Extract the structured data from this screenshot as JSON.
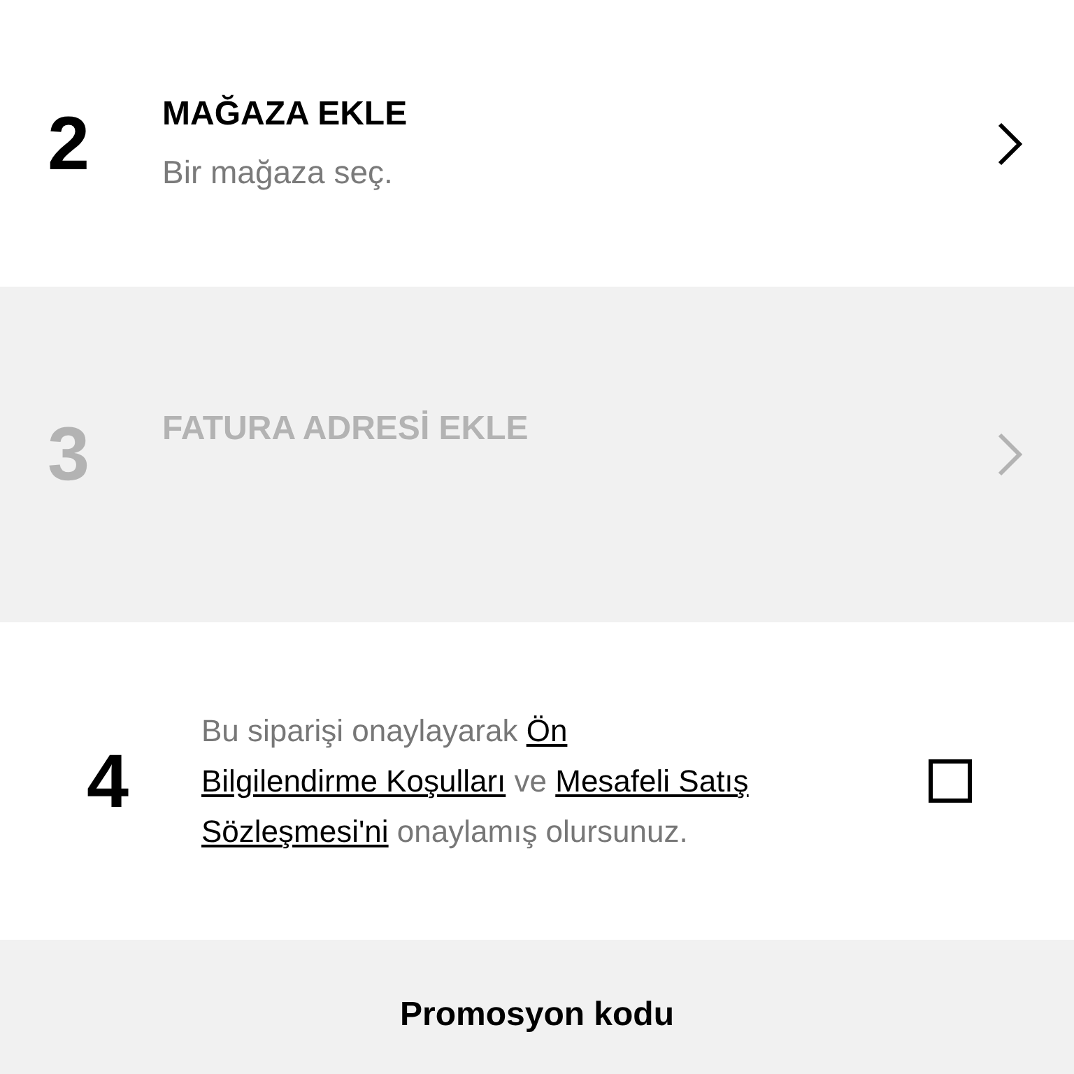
{
  "steps": [
    {
      "number": "2",
      "title": "MAĞAZA EKLE",
      "subtitle": "Bir mağaza seç.",
      "disabled": false
    },
    {
      "number": "3",
      "title": "FATURA ADRESİ EKLE",
      "disabled": true
    }
  ],
  "consent": {
    "number": "4",
    "checked": false,
    "lines": [
      [
        {
          "kind": "text",
          "text": "Bu siparişi onaylayarak "
        },
        {
          "kind": "link",
          "text": "Ön"
        }
      ],
      [
        {
          "kind": "link",
          "text": "Bilgilendirme Koşulları"
        },
        {
          "kind": "text",
          "text": " ve "
        },
        {
          "kind": "link",
          "text": "Mesafeli Satış"
        }
      ],
      [
        {
          "kind": "link",
          "text": "Sözleşmesi'ni"
        },
        {
          "kind": "text",
          "text": " onaylamış olursunuz."
        }
      ]
    ]
  },
  "promo": {
    "label": "Promosyon kodu"
  }
}
